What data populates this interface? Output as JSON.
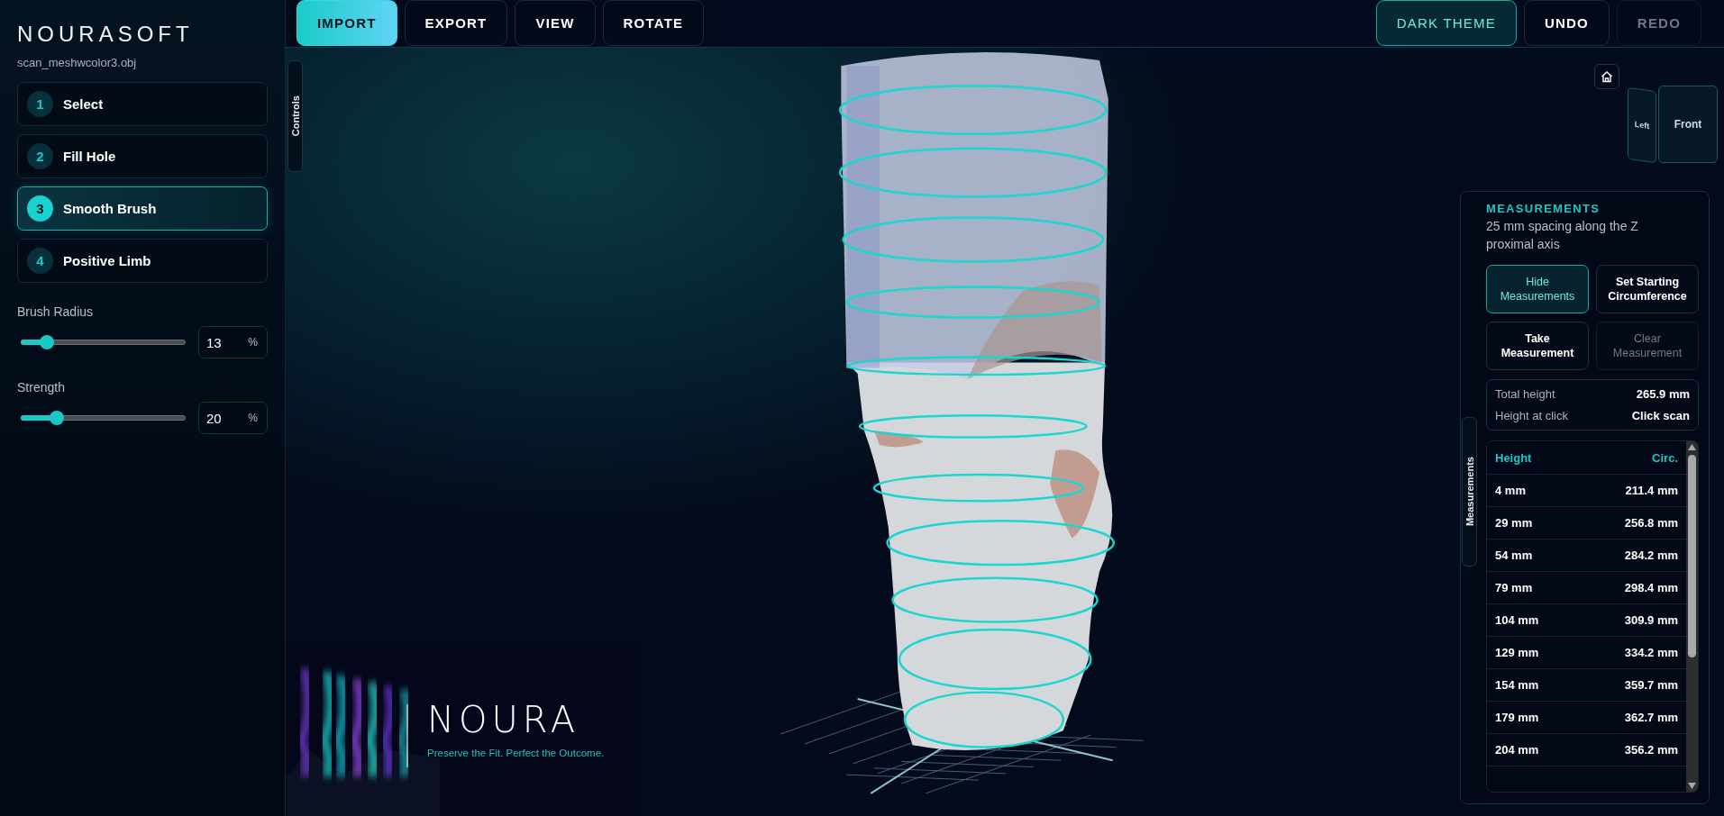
{
  "app": {
    "brand": "NOURASOFT",
    "file": "scan_meshwcolor3.obj"
  },
  "tools": [
    {
      "number": "1",
      "label": "Select",
      "selected": false
    },
    {
      "number": "2",
      "label": "Fill Hole",
      "selected": false
    },
    {
      "number": "3",
      "label": "Smooth Brush",
      "selected": true
    },
    {
      "number": "4",
      "label": "Positive Limb",
      "selected": false
    }
  ],
  "sliders": [
    {
      "label": "Brush Radius",
      "level": 0.16,
      "value": "13",
      "unit": "%"
    },
    {
      "label": "Strength",
      "level": 0.22,
      "value": "20",
      "unit": "%"
    }
  ],
  "toolbar": {
    "left": [
      {
        "label": "IMPORT",
        "selected": true
      },
      {
        "label": "EXPORT",
        "selected": false
      },
      {
        "label": "VIEW",
        "selected": false
      },
      {
        "label": "ROTATE",
        "selected": false
      }
    ],
    "right": [
      {
        "label": "DARK THEME",
        "on": true,
        "disabled": false
      },
      {
        "label": "UNDO",
        "on": false,
        "disabled": false
      },
      {
        "label": "REDO",
        "on": false,
        "disabled": true
      }
    ]
  },
  "controls_tab": {
    "label": "Controls"
  },
  "view_cube": {
    "faces": [
      {
        "kind": "side",
        "label": "Left"
      },
      {
        "kind": "front",
        "label": "Front"
      }
    ]
  },
  "banner": {
    "wordmark": "NOURA",
    "tagline": "Preserve the Fit. Perfect the Outcome."
  },
  "measurements": {
    "tab_label": "Measurements",
    "title": "MEASUREMENTS",
    "subtitle": "25 mm spacing along the Z proximal axis",
    "actions": [
      {
        "label": "Hide Measurements",
        "on": true,
        "disabled": false
      },
      {
        "label": "Set Starting Circumference",
        "on": false,
        "disabled": false
      },
      {
        "label": "Take Measurement",
        "on": false,
        "disabled": false
      },
      {
        "label": "Clear Measurement",
        "on": false,
        "disabled": true
      }
    ],
    "stats": [
      {
        "label": "Total height",
        "value": "265.9 mm"
      },
      {
        "label": "Height at click",
        "value": "Click scan"
      }
    ],
    "table": {
      "columns": [
        "Height",
        "Circ."
      ],
      "rows": [
        [
          "4 mm",
          "211.4 mm"
        ],
        [
          "29 mm",
          "256.8 mm"
        ],
        [
          "54 mm",
          "284.2 mm"
        ],
        [
          "79 mm",
          "298.4 mm"
        ],
        [
          "104 mm",
          "309.9 mm"
        ],
        [
          "129 mm",
          "334.2 mm"
        ],
        [
          "154 mm",
          "359.7 mm"
        ],
        [
          "179 mm",
          "362.7 mm"
        ],
        [
          "204 mm",
          "356.2 mm"
        ]
      ]
    }
  }
}
